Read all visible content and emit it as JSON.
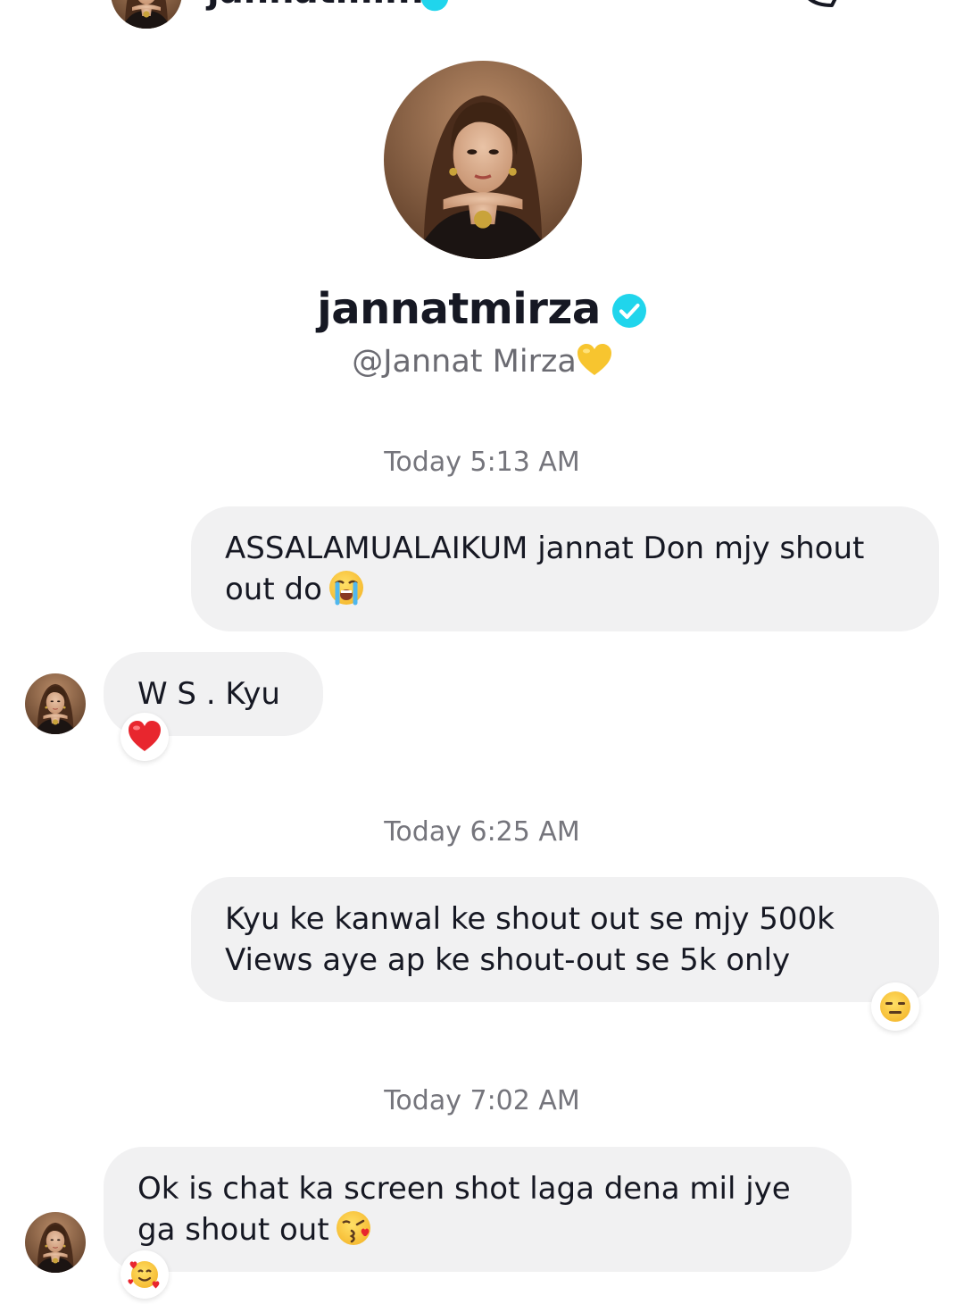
{
  "header": {
    "title": "jannatmir...",
    "back_icon": "chevron-left-icon",
    "call_icon": "phone-icon"
  },
  "profile": {
    "name": "jannatmirza",
    "handle": "@Jannat Mirza",
    "handle_emoji": "yellow-heart-emoji",
    "verified": true,
    "verified_color": "#20d5ec"
  },
  "messages": [
    {
      "timestamp": "Today 5:13 AM",
      "sender": "me",
      "text": "ASSALAMUALAIKUM  jannat Don mjy shout out do",
      "emoji": "loudly-crying-face"
    },
    {
      "sender": "jannatmirza",
      "text": "W S . Kyu",
      "reaction": "red-heart"
    },
    {
      "timestamp": "Today 6:25 AM",
      "sender": "me",
      "text": "Kyu ke kanwal ke shout out se mjy 500k Views aye ap ke shout-out se 5k only",
      "reaction": "expressionless-face"
    },
    {
      "timestamp": "Today 7:02 AM",
      "sender": "jannatmirza",
      "text": "Ok is chat ka screen shot laga dena mil jye ga shout out",
      "emoji": "face-blowing-a-kiss",
      "reaction": "smiling-face-with-hearts"
    }
  ],
  "colors": {
    "bubble": "#f1f1f2",
    "text": "#161823",
    "timestamp": "#75757c",
    "handle": "#6b6b72"
  }
}
